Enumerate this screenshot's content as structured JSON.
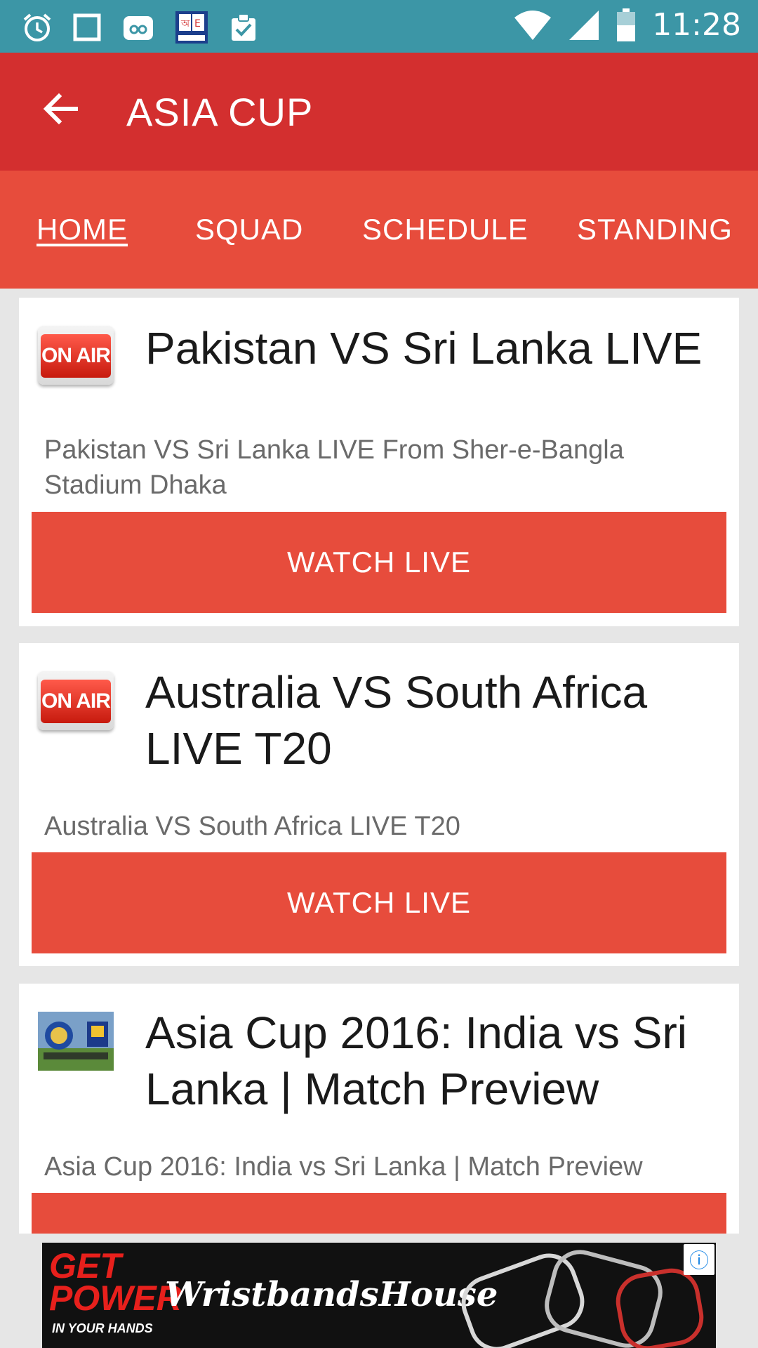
{
  "status_bar": {
    "time": "11:28",
    "left_icons": [
      "alarm-icon",
      "square-icon",
      "voicemail-icon",
      "bangla-english-app-icon",
      "clipboard-check-icon"
    ],
    "right_icons": [
      "wifi-icon",
      "signal-icon",
      "battery-icon"
    ],
    "background": "#3c96a6"
  },
  "app_bar": {
    "title": "ASIA CUP",
    "back_icon": "arrow-back-icon",
    "background": "#d32f2f"
  },
  "tabs": {
    "items": [
      {
        "label": "HOME",
        "active": true
      },
      {
        "label": "SQUAD",
        "active": false
      },
      {
        "label": "SCHEDULE",
        "active": false
      },
      {
        "label": "STANDING",
        "active": false
      }
    ],
    "background": "#e74c3c"
  },
  "cards": [
    {
      "icon": "on-air-icon",
      "icon_text": "ON AIR",
      "title": "Pakistan VS Sri Lanka LIVE",
      "description": "Pakistan VS Sri Lanka LIVE From Sher-e-Bangla Stadium Dhaka",
      "button": "WATCH LIVE"
    },
    {
      "icon": "on-air-icon",
      "icon_text": "ON AIR",
      "title": "Australia VS South Africa LIVE T20",
      "description": "Australia VS South Africa LIVE T20",
      "button": "WATCH LIVE"
    },
    {
      "icon": "cricket-logos-thumbnail",
      "title": "Asia Cup 2016: India vs Sri Lanka | Match Preview",
      "description": "Asia Cup 2016: India vs Sri Lanka | Match Preview",
      "button": ""
    }
  ],
  "ad": {
    "headline_1": "GET",
    "headline_2": "POWER",
    "tagline": "IN YOUR HANDS",
    "brand": "WristbandsHouse",
    "info_icon": "info-icon"
  },
  "colors": {
    "accent": "#e74c3c",
    "card_bg": "#ffffff",
    "page_bg": "#e6e6e6"
  }
}
